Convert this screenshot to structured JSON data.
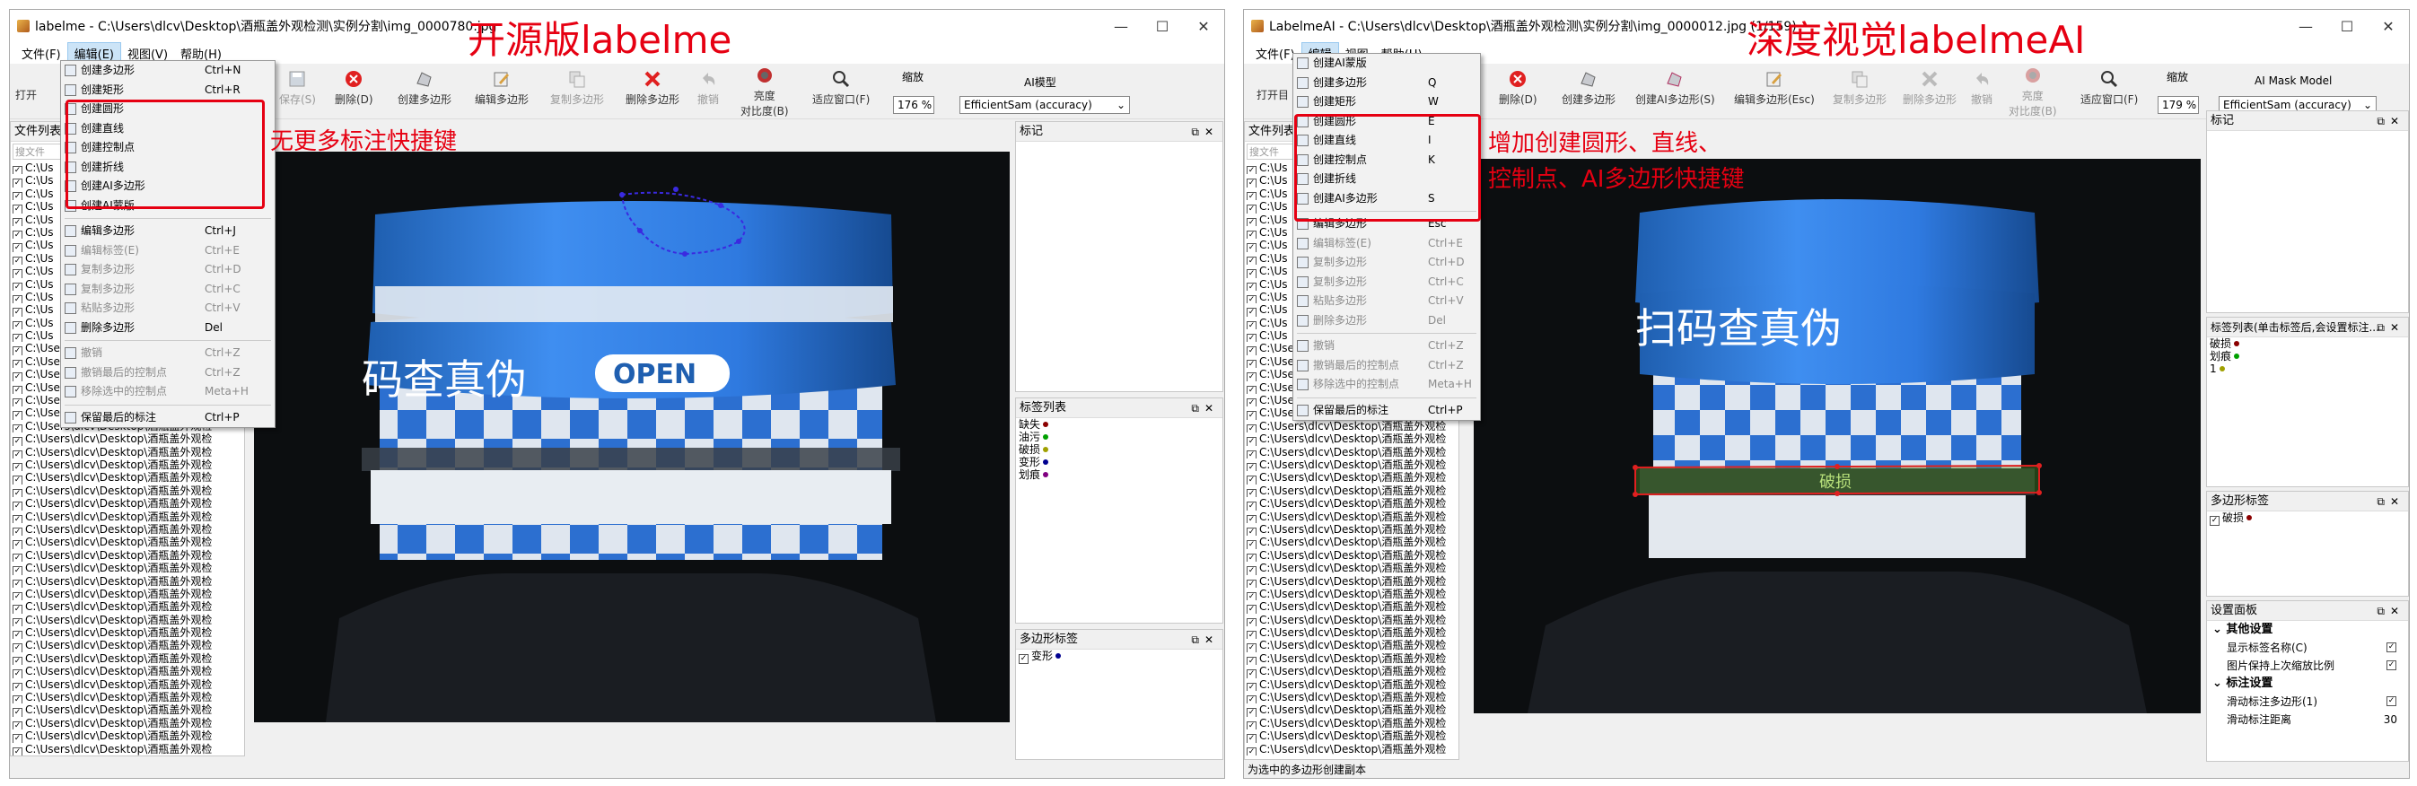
{
  "left": {
    "title": "labelme - C:\\Users\\dlcv\\Desktop\\酒瓶盖外观检测\\实例分割\\img_0000780.jpg",
    "annotation_title": "开源版labelme",
    "annotation_note": "无更多标注快捷键",
    "menubar": [
      "文件(F)",
      "编辑(E)",
      "视图(V)",
      "帮助(H)"
    ],
    "toolbar": {
      "open": "打开",
      "save": "保存(S)",
      "delete": "删除(D)",
      "create_polygon": "创建多边形",
      "edit_polygon": "编辑多边形",
      "copy_polygon": "复制多边形",
      "delete_polygon": "删除多边形",
      "undo": "撤销",
      "brightness_1": "亮度",
      "brightness_2": "对比度(B)",
      "fit_window": "适应窗口(F)",
      "zoom_label": "缩放",
      "zoom_value": "176 %",
      "ai_label": "AI模型",
      "ai_value": "EfficientSam (accuracy)"
    },
    "edit_menu": [
      {
        "label": "创建多边形",
        "shortcut": "Ctrl+N",
        "disabled": false
      },
      {
        "label": "创建矩形",
        "shortcut": "Ctrl+R",
        "disabled": false
      },
      {
        "label": "创建圆形",
        "shortcut": "",
        "disabled": false
      },
      {
        "label": "创建直线",
        "shortcut": "",
        "disabled": false
      },
      {
        "label": "创建控制点",
        "shortcut": "",
        "disabled": false
      },
      {
        "label": "创建折线",
        "shortcut": "",
        "disabled": false
      },
      {
        "label": "创建AI多边形",
        "shortcut": "",
        "disabled": false
      },
      {
        "label": "创建AI蒙版",
        "shortcut": "",
        "disabled": false
      },
      {
        "label": "编辑多边形",
        "shortcut": "Ctrl+J",
        "disabled": false
      },
      {
        "label": "编辑标签(E)",
        "shortcut": "Ctrl+E",
        "disabled": true
      },
      {
        "label": "复制多边形",
        "shortcut": "Ctrl+D",
        "disabled": true
      },
      {
        "label": "复制多边形",
        "shortcut": "Ctrl+C",
        "disabled": true
      },
      {
        "label": "粘贴多边形",
        "shortcut": "Ctrl+V",
        "disabled": true
      },
      {
        "label": "删除多边形",
        "shortcut": "Del",
        "disabled": false
      },
      {
        "label": "撤销",
        "shortcut": "Ctrl+Z",
        "disabled": true
      },
      {
        "label": "撤销最后的控制点",
        "shortcut": "Ctrl+Z",
        "disabled": true
      },
      {
        "label": "移除选中的控制点",
        "shortcut": "Meta+H",
        "disabled": true
      },
      {
        "label": "保留最后的标注",
        "shortcut": "Ctrl+P",
        "disabled": false
      }
    ],
    "file_list_title": "文件列表",
    "file_search_placeholder": "搜文件",
    "file_short": "C:\\Us",
    "file_path": "C:\\Users\\dlcv\\Desktop\\酒瓶盖外观检",
    "panel_marks": "标记",
    "panel_labels": "标签列表",
    "labels": [
      {
        "name": "缺失",
        "color": "#8b0000"
      },
      {
        "name": "油污",
        "color": "#00a000"
      },
      {
        "name": "破损",
        "color": "#a0a000"
      },
      {
        "name": "变形",
        "color": "#000090"
      },
      {
        "name": "划痕",
        "color": "#800080"
      }
    ],
    "panel_polygons": "多边形标签",
    "polygons": [
      {
        "name": "变形",
        "color": "#000090"
      }
    ],
    "cap_text": "码查真伪",
    "cap_open": "OPEN"
  },
  "right": {
    "title": "LabelmeAI - C:\\Users\\dlcv\\Desktop\\酒瓶盖外观检测\\实例分割\\img_0000012.jpg (1/159)",
    "annotation_title": "深度视觉labelmeAI",
    "annotation_note_1": "增加创建圆形、直线、",
    "annotation_note_2": "控制点、AI多边形快捷键",
    "menubar": [
      "文件(F)",
      "编辑",
      "视图",
      "帮助(H)"
    ],
    "toolbar": {
      "open": "打开目",
      "delete": "删除(D)",
      "create_polygon": "创建多边形",
      "create_ai": "创建AI多边形(S)",
      "edit_polygon": "编辑多边形(Esc)",
      "copy_polygon": "复制多边形",
      "delete_polygon": "删除多边形",
      "undo": "撤销",
      "brightness_1": "亮度",
      "brightness_2": "对比度(B)",
      "fit_window": "适应窗口(F)",
      "zoom_label": "缩放",
      "zoom_value": "179 %",
      "ai_label": "AI Mask Model",
      "ai_value": "EfficientSam (accuracy)"
    },
    "edit_menu": [
      {
        "label": "创建AI蒙版",
        "shortcut": "",
        "disabled": false
      },
      {
        "label": "创建多边形",
        "shortcut": "Q",
        "disabled": false
      },
      {
        "label": "创建矩形",
        "shortcut": "W",
        "disabled": false
      },
      {
        "label": "创建圆形",
        "shortcut": "E",
        "disabled": false
      },
      {
        "label": "创建直线",
        "shortcut": "I",
        "disabled": false
      },
      {
        "label": "创建控制点",
        "shortcut": "K",
        "disabled": false
      },
      {
        "label": "创建折线",
        "shortcut": "",
        "disabled": false
      },
      {
        "label": "创建AI多边形",
        "shortcut": "S",
        "disabled": false
      },
      {
        "label": "编辑多边形",
        "shortcut": "Esc",
        "disabled": false
      },
      {
        "label": "编辑标签(E)",
        "shortcut": "Ctrl+E",
        "disabled": true
      },
      {
        "label": "复制多边形",
        "shortcut": "Ctrl+D",
        "disabled": true
      },
      {
        "label": "复制多边形",
        "shortcut": "Ctrl+C",
        "disabled": true
      },
      {
        "label": "粘贴多边形",
        "shortcut": "Ctrl+V",
        "disabled": true
      },
      {
        "label": "删除多边形",
        "shortcut": "Del",
        "disabled": true
      },
      {
        "label": "撤销",
        "shortcut": "Ctrl+Z",
        "disabled": true
      },
      {
        "label": "撤销最后的控制点",
        "shortcut": "Ctrl+Z",
        "disabled": true
      },
      {
        "label": "移除选中的控制点",
        "shortcut": "Meta+H",
        "disabled": true
      },
      {
        "label": "保留最后的标注",
        "shortcut": "Ctrl+P",
        "disabled": false
      }
    ],
    "file_list_title": "文件列表",
    "file_search_placeholder": "搜文件",
    "file_short": "C:\\Us",
    "file_path": "C:\\Users\\dlcv\\Desktop\\酒瓶盖外观检",
    "panel_marks": "标记",
    "panel_labels": "标签列表(单击标签后,会设置标注...",
    "labels": [
      {
        "name": "破损",
        "color": "#8b0000"
      },
      {
        "name": "划痕",
        "color": "#00a000"
      },
      {
        "name": "1",
        "color": "#a0a000"
      }
    ],
    "panel_polygons": "多边形标签",
    "polygons": [
      {
        "name": "破损",
        "color": "#8b0000"
      }
    ],
    "panel_settings": "设置面板",
    "settings_group_1": "其他设置",
    "setting_show_label_name": "显示标签名称(C)",
    "setting_keep_zoom": "图片保持上次缩放比例",
    "settings_group_2": "标注设置",
    "setting_slide_polygon": "滑动标注多边形(1)",
    "setting_slide_distance": "滑动标注距离",
    "setting_slide_distance_value": "30",
    "polygon_label_on_canvas": "破损",
    "cap_text": "扫码查真伪",
    "status": "为选中的多边形创建副本"
  }
}
